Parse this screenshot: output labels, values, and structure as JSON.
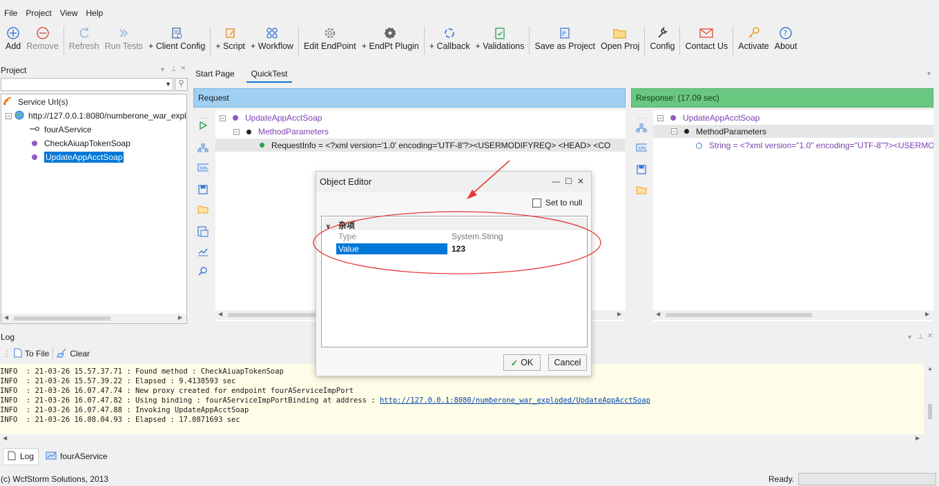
{
  "menu": [
    "File",
    "Project",
    "View",
    "Help"
  ],
  "toolbar": {
    "add": "Add",
    "remove": "Remove",
    "refresh": "Refresh",
    "run_tests": "Run Tests",
    "client_config": "+ Client Config",
    "script": "+ Script",
    "workflow": "+ Workflow",
    "edit_endpoint": "Edit EndPoint",
    "endpt_plugin": "+ EndPt Plugin",
    "callback": "+ Callback",
    "validations": "+ Validations",
    "save_as_project": "Save as Project",
    "open_proj": "Open Proj",
    "config": "Config",
    "contact_us": "Contact Us",
    "activate": "Activate",
    "about": "About"
  },
  "project": {
    "title": "Project",
    "tree": {
      "root": "Service Url(s)",
      "url": "http://127.0.0.1:8080/numberone_war_expl",
      "service": "fourAService",
      "methods": [
        "CheckAiuapTokenSoap",
        "UpdateAppAcctSoap"
      ]
    }
  },
  "tabs": [
    "Start Page",
    "QuickTest"
  ],
  "request": {
    "header": "Request",
    "method": "UpdateAppAcctSoap",
    "params": "MethodParameters",
    "request_info": "RequestInfo = <?xml version='1.0' encoding='UTF-8'?><USERMODIFYREQ>    <HEAD>      <CO"
  },
  "response": {
    "header": "Response: (17.09 sec)",
    "method": "UpdateAppAcctSoap",
    "params": "MethodParameters",
    "string": "String = <?xml version=\"1.0\" encoding=\"UTF-8\"?><USERMO"
  },
  "dialog": {
    "title": "Object Editor",
    "set_to_null": "Set to null",
    "category": "杂项",
    "type_label": "Type",
    "type_value": "System.String",
    "value_label": "Value",
    "value_value": "123",
    "ok": "OK",
    "cancel": "Cancel"
  },
  "log": {
    "title": "Log",
    "to_file": "To File",
    "clear": "Clear",
    "lines": [
      "INFO  : 21-03-26 15.57.37.71 : Found method : CheckAiuapTokenSoap",
      "INFO  : 21-03-26 15.57.39.22 : Elapsed : 9.4138593 sec",
      "INFO  : 21-03-26 16.07.47.74 : New proxy created for endpoint fourAServiceImpPort",
      "INFO  : 21-03-26 16.07.47.82 : Using binding : fourAServiceImpPortBinding at address : ",
      "INFO  : 21-03-26 16.07.47.88 : Invoking UpdateAppAcctSoap",
      "INFO  : 21-03-26 16.08.04.93 : Elapsed : 17.0871693 sec"
    ],
    "link": "http://127.0.0.1:8080/numberone_war_exploded/UpdateAppAcctSoap"
  },
  "bottom_tabs": [
    "Log",
    "fourAService"
  ],
  "status": {
    "copyright": "(c) WcfStorm Solutions, 2013",
    "ready": "Ready."
  },
  "colors": {
    "request_header": "#9fd0f3",
    "response_header": "#69c77f",
    "selection": "#0078d7",
    "annotation": "#e53935",
    "log_bg": "#fefde8"
  }
}
